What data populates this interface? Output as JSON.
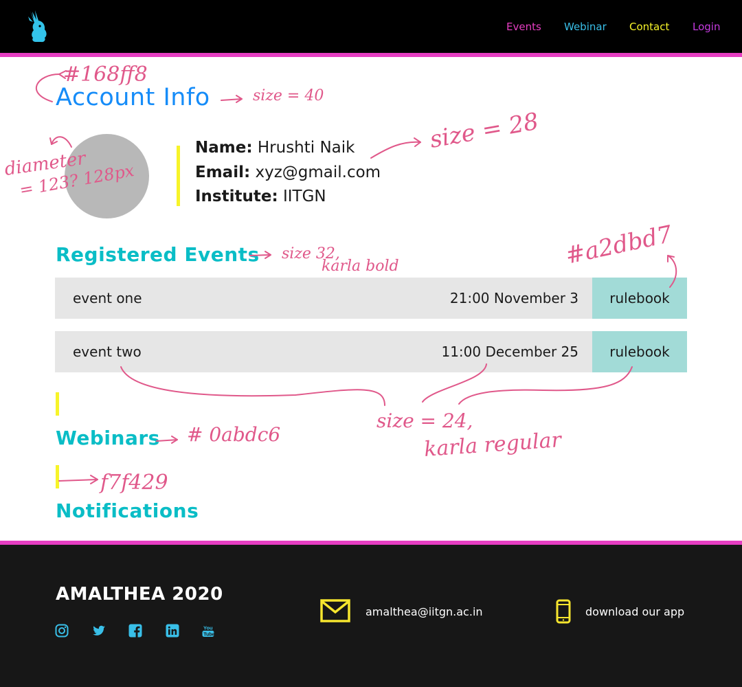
{
  "header": {
    "nav": [
      {
        "label": "Events",
        "color": "#e63ec2"
      },
      {
        "label": "Webinar",
        "color": "#39bfe8"
      },
      {
        "label": "Contact",
        "color": "#f7f429"
      },
      {
        "label": "Login",
        "color": "#c63be0"
      }
    ],
    "logo_icon": "rabbit-logo-icon",
    "accent_border_color": "#e63ec2"
  },
  "account": {
    "title": "Account Info",
    "title_color": "#168cf8",
    "fields": [
      {
        "label": "Name:",
        "value": "Hrushti Naik"
      },
      {
        "label": "Email:",
        "value": "xyz@gmail.com"
      },
      {
        "label": "Institute:",
        "value": "IITGN"
      }
    ]
  },
  "registered_events": {
    "title": "Registered Events",
    "title_color": "#0abdc6",
    "rows": [
      {
        "name": "event one",
        "time": "21:00 November 3",
        "button": "rulebook"
      },
      {
        "name": "event two",
        "time": "11:00 December 25",
        "button": "rulebook"
      }
    ],
    "row_color": "#e6e6e6",
    "button_color": "#a2dbd7"
  },
  "webinars": {
    "title": "Webinars",
    "marker_color": "#f7f429"
  },
  "notifications": {
    "title": "Notifications"
  },
  "annotations": {
    "account_color": "#168ff8",
    "account_size": "size = 40",
    "diameter_1": "diameter",
    "diameter_2": "= 123? 128px",
    "info_size": "size = 28",
    "events_size_1": "size 32,",
    "events_size_2": "karla bold",
    "button_color": "#a2dbd7",
    "webinars_color": "# 0abdc6",
    "marker_color": "f7f429",
    "row_size_1": "size = 24,",
    "row_size_2": "karla regular"
  },
  "footer": {
    "brand": "AMALTHEA 2020",
    "social_icons": [
      "instagram-icon",
      "twitter-icon",
      "facebook-icon",
      "linkedin-icon",
      "youtube-icon"
    ],
    "email": "amalthea@iitgn.ac.in",
    "app_text": "download our app",
    "icon_color_blue": "#39bfe8",
    "icon_color_yellow": "#f7e62e"
  }
}
